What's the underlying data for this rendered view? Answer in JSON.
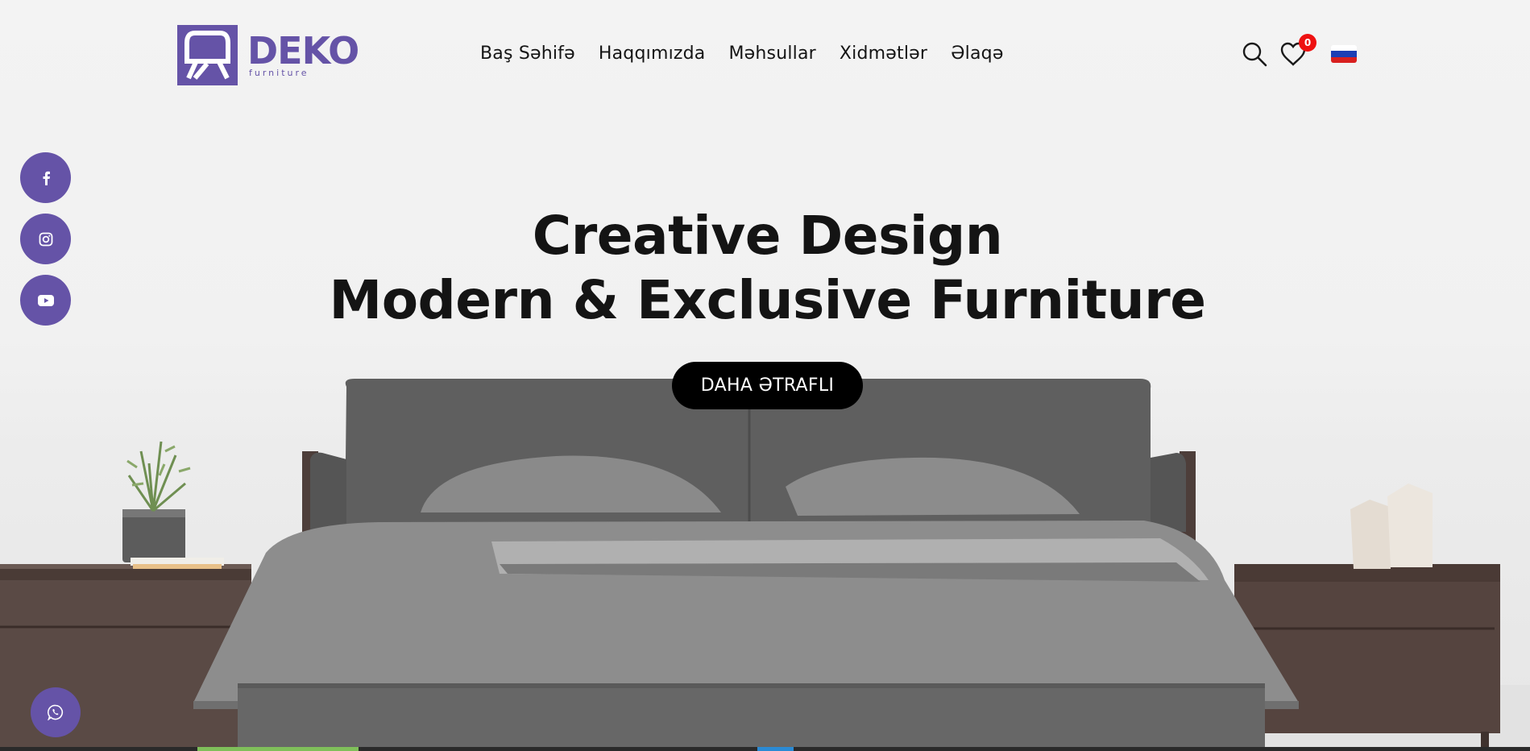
{
  "brand": {
    "name": "DEKO",
    "tagline": "furniture",
    "color": "#6553a7"
  },
  "nav": {
    "items": [
      {
        "label": "Baş Səhifə"
      },
      {
        "label": "Haqqımızda"
      },
      {
        "label": "Məhsullar"
      },
      {
        "label": "Xidmətlər"
      },
      {
        "label": "Əlaqə"
      }
    ]
  },
  "header_icons": {
    "search": "search-icon",
    "wishlist": "heart-icon",
    "wishlist_count": "0",
    "language": "ru-flag-icon"
  },
  "social": [
    {
      "icon": "facebook-icon"
    },
    {
      "icon": "instagram-icon"
    },
    {
      "icon": "youtube-icon"
    }
  ],
  "hero": {
    "title_line1": "Creative Design",
    "title_line2": "Modern & Exclusive Furniture",
    "cta_label": "DAHA ƏTRAFLI"
  },
  "whatsapp": {
    "icon": "whatsapp-icon"
  },
  "colors": {
    "accent": "#6553a7",
    "badge": "#ee1111",
    "text": "#151515",
    "cta_bg": "#000000"
  }
}
